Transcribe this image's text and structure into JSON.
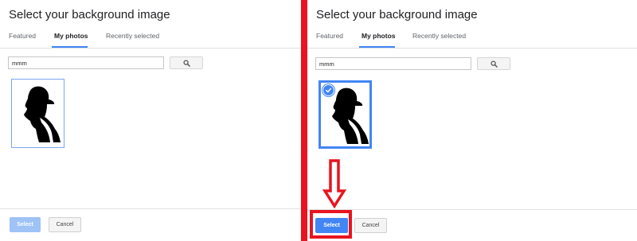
{
  "colors": {
    "accent": "#4285f4",
    "accent_disabled": "#9fc2f7",
    "annotation_red": "#e8141f",
    "divider": "#e0e0e0"
  },
  "left_panel": {
    "title": "Select your background image",
    "tabs": [
      "Featured",
      "My photos",
      "Recently selected"
    ],
    "active_tab": "My photos",
    "search": {
      "value": "mmm",
      "placeholder": ""
    },
    "search_icon": "search-icon",
    "photo": {
      "selected": false,
      "image": "silhouette-man-in-cap"
    },
    "select_label": "Select",
    "select_enabled": false,
    "cancel_label": "Cancel"
  },
  "right_panel": {
    "title": "Select your background image",
    "tabs": [
      "Featured",
      "My photos",
      "Recently selected"
    ],
    "active_tab": "My photos",
    "search": {
      "value": "mmm",
      "placeholder": ""
    },
    "search_icon": "search-icon",
    "photo": {
      "selected": true,
      "image": "silhouette-man-in-cap",
      "badge_icon": "checkmark-icon"
    },
    "select_label": "Select",
    "select_enabled": true,
    "cancel_label": "Cancel"
  },
  "annotations": {
    "arrow_icon": "down-arrow-icon",
    "highlight": "select-button-highlight"
  }
}
